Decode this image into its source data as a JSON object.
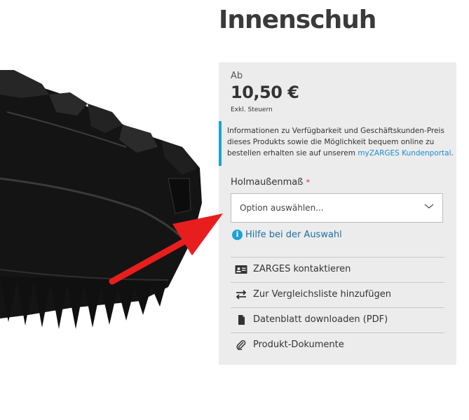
{
  "product": {
    "title": "Innenschuh",
    "price_prefix": "Ab",
    "price": "10,50 €",
    "tax_note": "Exkl. Steuern"
  },
  "info": {
    "text": "Informationen zu Verfügbarkeit und Geschäftskunden-Preis dieses Produkts sowie die Möglichkeit bequem online zu bestellen erhalten sie auf unserem ",
    "link_text": "myZARGES Kundenportal",
    "suffix": "."
  },
  "field": {
    "label": "Holmaußenmaß",
    "required_mark": "*",
    "placeholder": "Option auswählen..."
  },
  "help": {
    "label": "Hilfe bei der Auswahl",
    "icon": "info-icon"
  },
  "actions": [
    {
      "label": "ZARGES kontaktieren",
      "icon": "contact-card-icon"
    },
    {
      "label": "Zur Vergleichsliste hinzufügen",
      "icon": "compare-arrows-icon"
    },
    {
      "label": "Datenblatt downloaden (PDF)",
      "icon": "document-icon"
    },
    {
      "label": "Produkt-Dokumente",
      "icon": "paperclip-icon"
    }
  ],
  "colors": {
    "accent": "#1ba1d7",
    "link": "#1b8fd0",
    "panel_bg": "#ececec",
    "required": "#e11c24",
    "arrow": "#e81e1e"
  }
}
